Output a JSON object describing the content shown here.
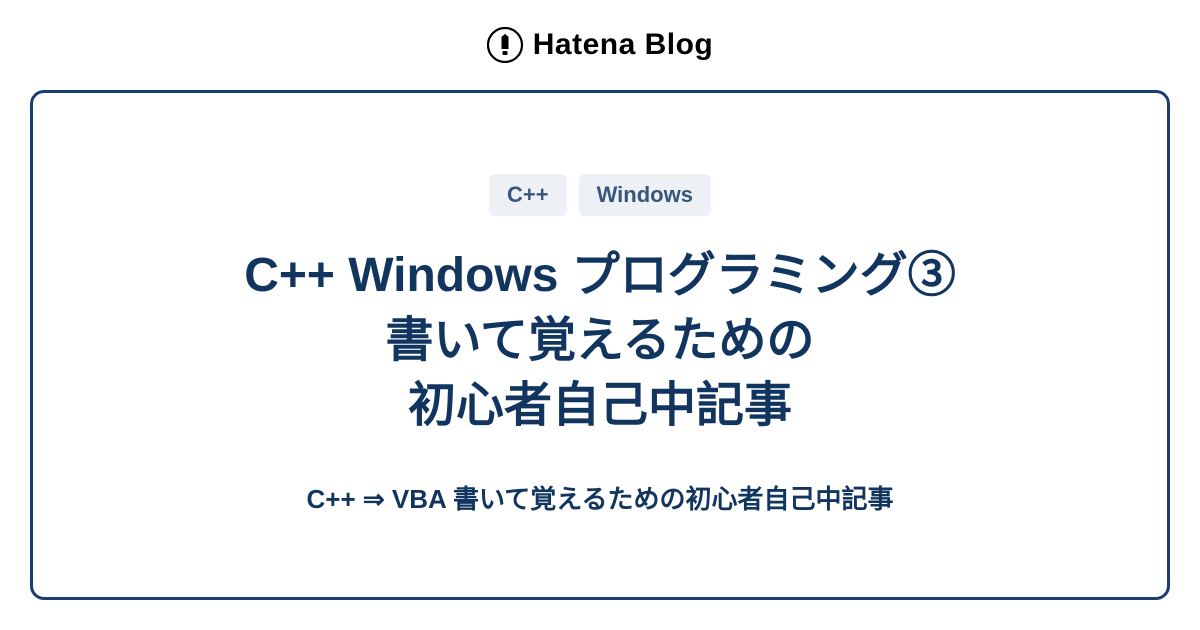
{
  "header": {
    "brand": "Hatena Blog"
  },
  "card": {
    "tags": [
      "C++",
      "Windows"
    ],
    "title_lines": [
      "C++ Windows プログラミング③",
      "書いて覚えるための",
      "初心者自己中記事"
    ],
    "subtitle": "C++ ⇒ VBA 書いて覚えるための初心者自己中記事"
  }
}
